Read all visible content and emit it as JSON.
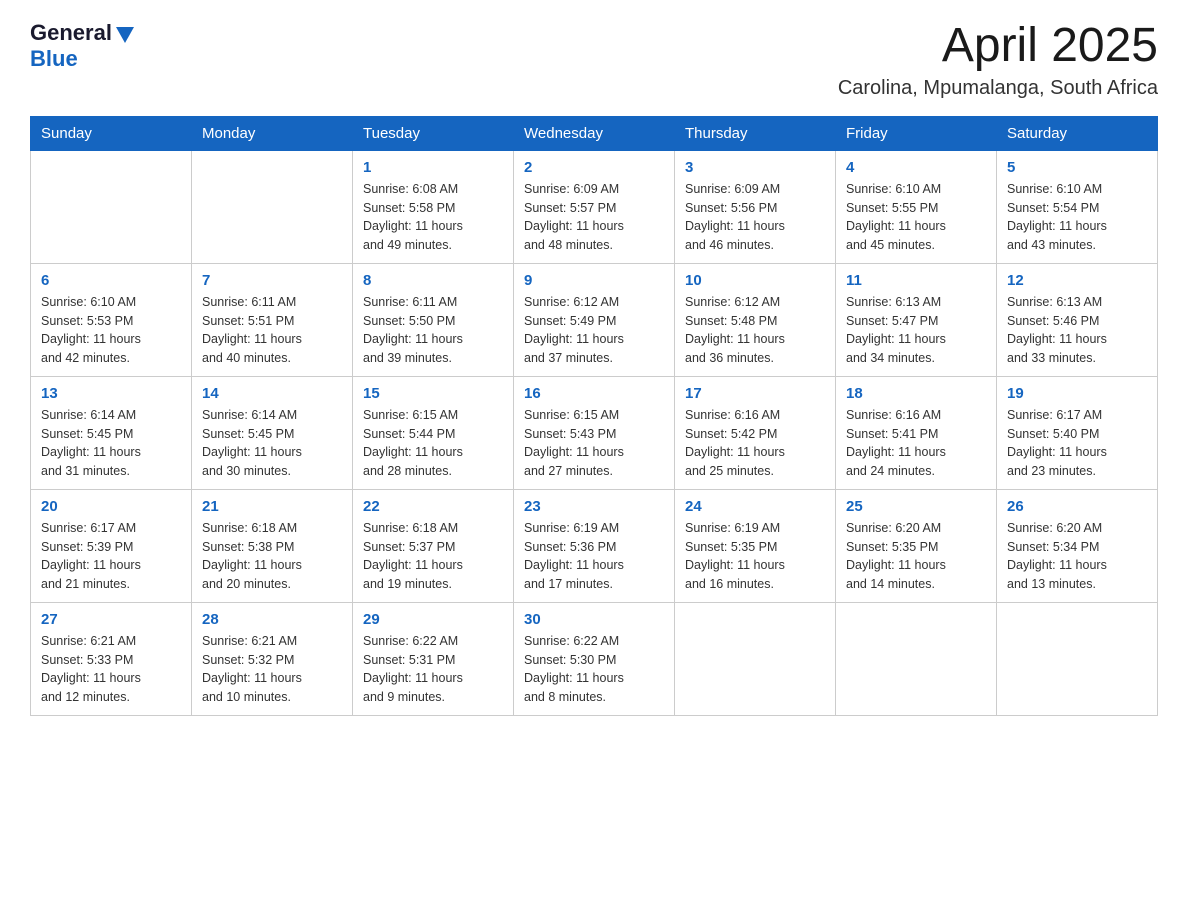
{
  "header": {
    "logo_general": "General",
    "logo_blue": "Blue",
    "month_year": "April 2025",
    "location": "Carolina, Mpumalanga, South Africa"
  },
  "weekdays": [
    "Sunday",
    "Monday",
    "Tuesday",
    "Wednesday",
    "Thursday",
    "Friday",
    "Saturday"
  ],
  "weeks": [
    [
      {
        "day": "",
        "info": ""
      },
      {
        "day": "",
        "info": ""
      },
      {
        "day": "1",
        "info": "Sunrise: 6:08 AM\nSunset: 5:58 PM\nDaylight: 11 hours\nand 49 minutes."
      },
      {
        "day": "2",
        "info": "Sunrise: 6:09 AM\nSunset: 5:57 PM\nDaylight: 11 hours\nand 48 minutes."
      },
      {
        "day": "3",
        "info": "Sunrise: 6:09 AM\nSunset: 5:56 PM\nDaylight: 11 hours\nand 46 minutes."
      },
      {
        "day": "4",
        "info": "Sunrise: 6:10 AM\nSunset: 5:55 PM\nDaylight: 11 hours\nand 45 minutes."
      },
      {
        "day": "5",
        "info": "Sunrise: 6:10 AM\nSunset: 5:54 PM\nDaylight: 11 hours\nand 43 minutes."
      }
    ],
    [
      {
        "day": "6",
        "info": "Sunrise: 6:10 AM\nSunset: 5:53 PM\nDaylight: 11 hours\nand 42 minutes."
      },
      {
        "day": "7",
        "info": "Sunrise: 6:11 AM\nSunset: 5:51 PM\nDaylight: 11 hours\nand 40 minutes."
      },
      {
        "day": "8",
        "info": "Sunrise: 6:11 AM\nSunset: 5:50 PM\nDaylight: 11 hours\nand 39 minutes."
      },
      {
        "day": "9",
        "info": "Sunrise: 6:12 AM\nSunset: 5:49 PM\nDaylight: 11 hours\nand 37 minutes."
      },
      {
        "day": "10",
        "info": "Sunrise: 6:12 AM\nSunset: 5:48 PM\nDaylight: 11 hours\nand 36 minutes."
      },
      {
        "day": "11",
        "info": "Sunrise: 6:13 AM\nSunset: 5:47 PM\nDaylight: 11 hours\nand 34 minutes."
      },
      {
        "day": "12",
        "info": "Sunrise: 6:13 AM\nSunset: 5:46 PM\nDaylight: 11 hours\nand 33 minutes."
      }
    ],
    [
      {
        "day": "13",
        "info": "Sunrise: 6:14 AM\nSunset: 5:45 PM\nDaylight: 11 hours\nand 31 minutes."
      },
      {
        "day": "14",
        "info": "Sunrise: 6:14 AM\nSunset: 5:45 PM\nDaylight: 11 hours\nand 30 minutes."
      },
      {
        "day": "15",
        "info": "Sunrise: 6:15 AM\nSunset: 5:44 PM\nDaylight: 11 hours\nand 28 minutes."
      },
      {
        "day": "16",
        "info": "Sunrise: 6:15 AM\nSunset: 5:43 PM\nDaylight: 11 hours\nand 27 minutes."
      },
      {
        "day": "17",
        "info": "Sunrise: 6:16 AM\nSunset: 5:42 PM\nDaylight: 11 hours\nand 25 minutes."
      },
      {
        "day": "18",
        "info": "Sunrise: 6:16 AM\nSunset: 5:41 PM\nDaylight: 11 hours\nand 24 minutes."
      },
      {
        "day": "19",
        "info": "Sunrise: 6:17 AM\nSunset: 5:40 PM\nDaylight: 11 hours\nand 23 minutes."
      }
    ],
    [
      {
        "day": "20",
        "info": "Sunrise: 6:17 AM\nSunset: 5:39 PM\nDaylight: 11 hours\nand 21 minutes."
      },
      {
        "day": "21",
        "info": "Sunrise: 6:18 AM\nSunset: 5:38 PM\nDaylight: 11 hours\nand 20 minutes."
      },
      {
        "day": "22",
        "info": "Sunrise: 6:18 AM\nSunset: 5:37 PM\nDaylight: 11 hours\nand 19 minutes."
      },
      {
        "day": "23",
        "info": "Sunrise: 6:19 AM\nSunset: 5:36 PM\nDaylight: 11 hours\nand 17 minutes."
      },
      {
        "day": "24",
        "info": "Sunrise: 6:19 AM\nSunset: 5:35 PM\nDaylight: 11 hours\nand 16 minutes."
      },
      {
        "day": "25",
        "info": "Sunrise: 6:20 AM\nSunset: 5:35 PM\nDaylight: 11 hours\nand 14 minutes."
      },
      {
        "day": "26",
        "info": "Sunrise: 6:20 AM\nSunset: 5:34 PM\nDaylight: 11 hours\nand 13 minutes."
      }
    ],
    [
      {
        "day": "27",
        "info": "Sunrise: 6:21 AM\nSunset: 5:33 PM\nDaylight: 11 hours\nand 12 minutes."
      },
      {
        "day": "28",
        "info": "Sunrise: 6:21 AM\nSunset: 5:32 PM\nDaylight: 11 hours\nand 10 minutes."
      },
      {
        "day": "29",
        "info": "Sunrise: 6:22 AM\nSunset: 5:31 PM\nDaylight: 11 hours\nand 9 minutes."
      },
      {
        "day": "30",
        "info": "Sunrise: 6:22 AM\nSunset: 5:30 PM\nDaylight: 11 hours\nand 8 minutes."
      },
      {
        "day": "",
        "info": ""
      },
      {
        "day": "",
        "info": ""
      },
      {
        "day": "",
        "info": ""
      }
    ]
  ]
}
